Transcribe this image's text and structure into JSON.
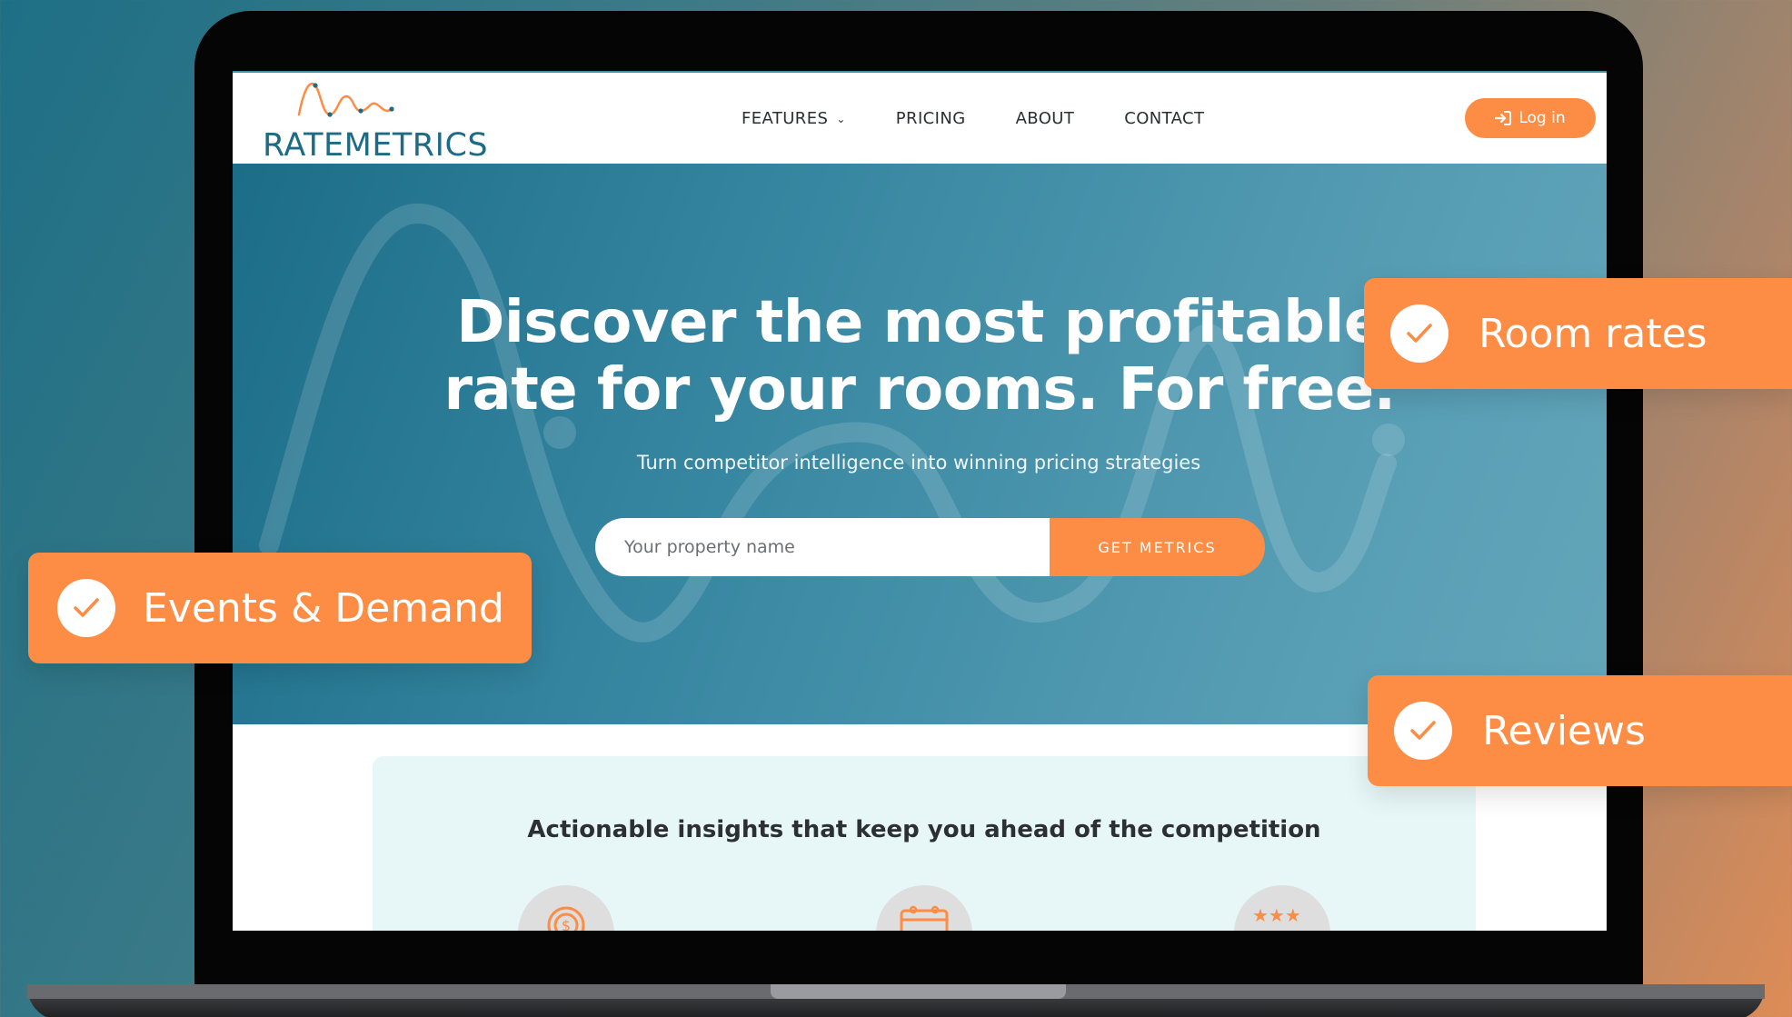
{
  "brand": {
    "name": "RATEMETRICS",
    "primary_color": "#1e6b85",
    "accent_color": "#fd8c45"
  },
  "nav": {
    "items": [
      {
        "label": "FEATURES",
        "has_dropdown": true
      },
      {
        "label": "PRICING"
      },
      {
        "label": "ABOUT"
      },
      {
        "label": "CONTACT"
      }
    ],
    "login_label": "Log in"
  },
  "hero": {
    "title_line1": "Discover the most profitable",
    "title_line2": "rate for your rooms. For free.",
    "subtitle": "Turn competitor intelligence into winning pricing strategies",
    "search_placeholder": "Your property name",
    "cta_label": "GET METRICS"
  },
  "insights": {
    "title": "Actionable insights that keep you ahead of the competition",
    "icons": [
      "dollar-coin-icon",
      "calendar-icon",
      "star-rating-icon"
    ]
  },
  "badges": [
    {
      "label": "Events & Demand"
    },
    {
      "label": "Room rates"
    },
    {
      "label": "Reviews"
    }
  ]
}
